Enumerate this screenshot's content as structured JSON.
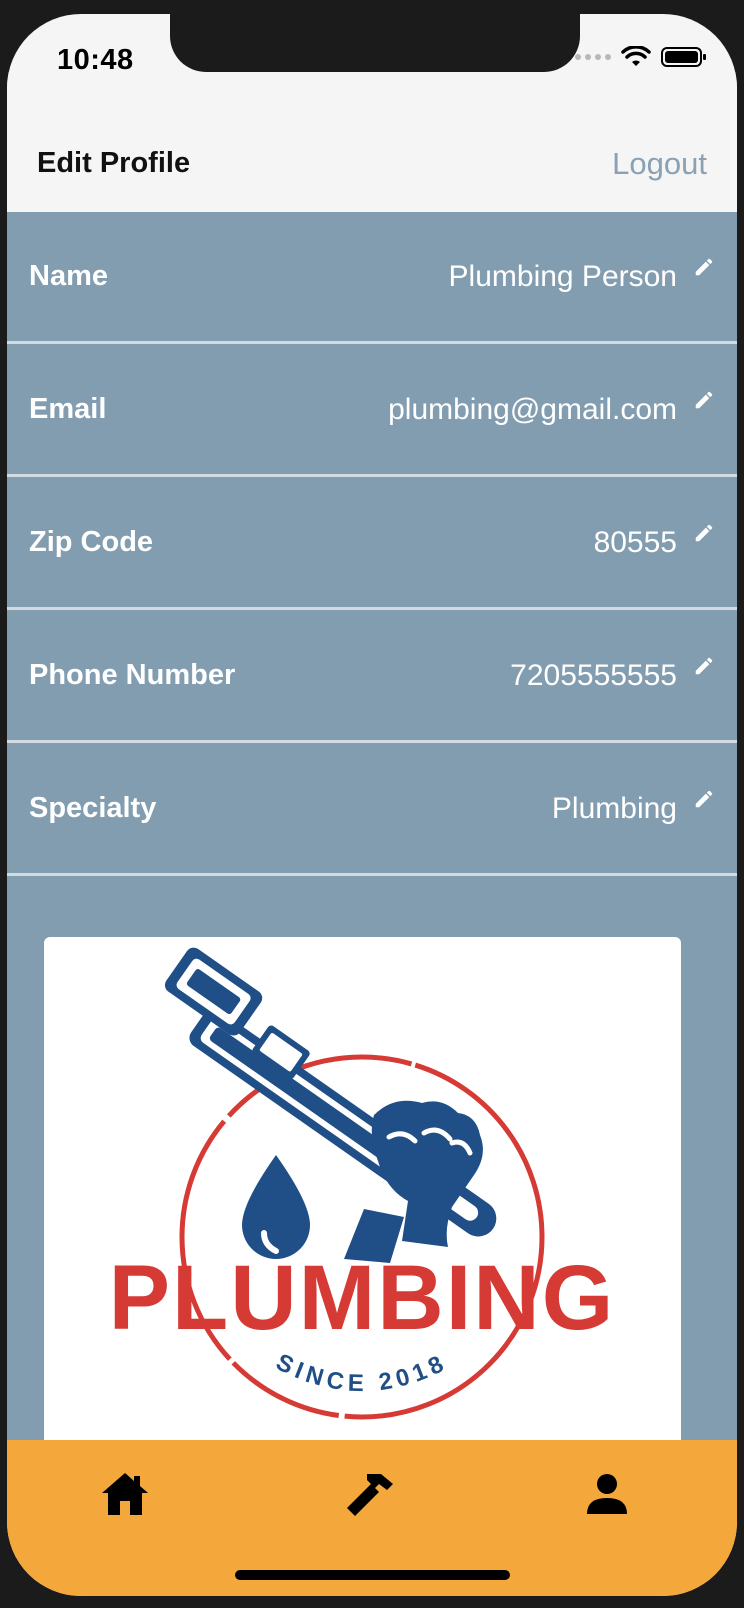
{
  "status_bar": {
    "time": "10:48"
  },
  "header": {
    "title": "Edit Profile",
    "logout_label": "Logout"
  },
  "profile_fields": [
    {
      "label": "Name",
      "value": "Plumbing Person"
    },
    {
      "label": "Email",
      "value": "plumbing@gmail.com"
    },
    {
      "label": "Zip Code",
      "value": "80555"
    },
    {
      "label": "Phone Number",
      "value": "7205555555"
    },
    {
      "label": "Specialty",
      "value": "Plumbing"
    }
  ],
  "logo": {
    "wordmark": "PLUMBING",
    "tagline": "SINCE 2018"
  },
  "tabbar": {
    "items": [
      "home-icon",
      "hammer-icon",
      "person-icon"
    ]
  },
  "colors": {
    "content_bg": "#829db0",
    "tabbar_bg": "#f4a73b",
    "logo_blue": "#1f4f86",
    "logo_red": "#d63a34"
  }
}
